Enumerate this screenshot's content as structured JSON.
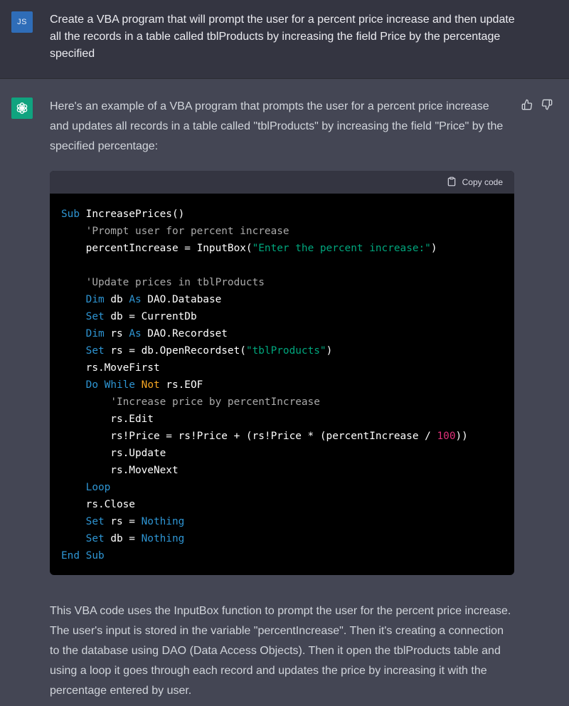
{
  "user": {
    "avatar_initials": "JS",
    "message": "Create a VBA program that will prompt the user for a percent price increase and then update all the records in a table called tblProducts by increasing the field Price by the percentage specified"
  },
  "assistant": {
    "avatar_icon": "openai-logo-icon",
    "intro": "Here's an example of a VBA program that prompts the user for a percent price increase and updates all records in a table called \"tblProducts\" by increasing the field \"Price\" by the specified percentage:",
    "copy_code_label": "Copy code",
    "feedback": {
      "thumbs_up_icon": "thumbs-up-icon",
      "thumbs_down_icon": "thumbs-down-icon"
    },
    "code": {
      "language": "VBA",
      "lines": [
        "Sub IncreasePrices()",
        "    'Prompt user for percent increase",
        "    percentIncrease = InputBox(\"Enter the percent increase:\")",
        "",
        "    'Update prices in tblProducts",
        "    Dim db As DAO.Database",
        "    Set db = CurrentDb",
        "    Dim rs As DAO.Recordset",
        "    Set rs = db.OpenRecordset(\"tblProducts\")",
        "    rs.MoveFirst",
        "    Do While Not rs.EOF",
        "        'Increase price by percentIncrease",
        "        rs.Edit",
        "        rs!Price = rs!Price + (rs!Price * (percentIncrease / 100))",
        "        rs.Update",
        "        rs.MoveNext",
        "    Loop",
        "    rs.Close",
        "    Set rs = Nothing",
        "    Set db = Nothing",
        "End Sub"
      ]
    },
    "outro": "This VBA code uses the InputBox function to prompt the user for the percent price increase. The user's input is stored in the variable \"percentIncrease\". Then it's creating a connection to the database using DAO (Data Access Objects). Then it open the tblProducts table and using a loop it goes through each record and updates the price by increasing it with the percentage entered by user."
  },
  "colors": {
    "user_bg": "#343541",
    "assistant_bg": "#444654",
    "code_bg": "#000000",
    "code_header_bg": "#343541",
    "keyword": "#2e95d3",
    "comment": "#a9a9a9",
    "string": "#00a67d",
    "not_keyword": "#f5a623",
    "number": "#df3079",
    "gpt_avatar": "#10a37f",
    "user_avatar": "#2f6db8"
  }
}
